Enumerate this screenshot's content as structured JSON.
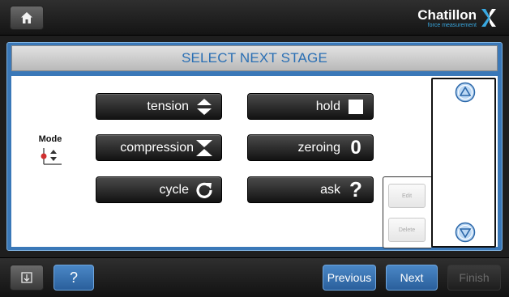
{
  "header": {
    "home_icon": "home-icon",
    "brand_name": "Chatillon",
    "brand_tagline": "force measurement",
    "brand_colors": {
      "text": "#ffffff",
      "accent": "#39a8e0"
    }
  },
  "title": "SELECT NEXT STAGE",
  "mode": {
    "label": "Mode",
    "icon": "mode-icon"
  },
  "stages": [
    {
      "label": "tension",
      "icon": "double-arrow-icon"
    },
    {
      "label": "hold",
      "icon": "square-icon"
    },
    {
      "label": "compression",
      "icon": "compress-arrows-icon"
    },
    {
      "label": "zeroing",
      "glyph": "0",
      "icon": "zero-icon"
    },
    {
      "label": "cycle",
      "icon": "refresh-icon"
    },
    {
      "label": "ask",
      "glyph": "?",
      "icon": "question-icon"
    }
  ],
  "list_controls": {
    "edit": "Edit",
    "delete": "Delete",
    "up_icon": "arrow-up-icon",
    "down_icon": "arrow-down-icon"
  },
  "footer": {
    "export_icon": "export-icon",
    "help": "?",
    "previous": "Previous",
    "next": "Next",
    "finish": "Finish"
  },
  "colors": {
    "accent": "#2a6fb4",
    "frame": "#3a78b8",
    "button_dark": "#121212",
    "button_blue": "#3a76b6"
  }
}
